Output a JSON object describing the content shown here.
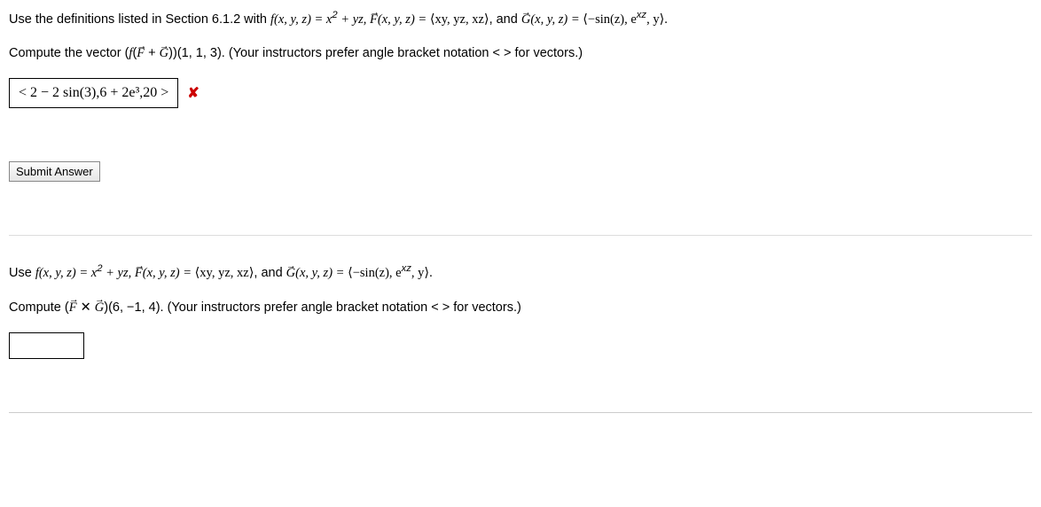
{
  "q1": {
    "defs_prefix": "Use the definitions listed in Section 6.1.2 with ",
    "f_expr": "f(x, y, z) = x",
    "f_exp": "2",
    "f_tail": " + yz, ",
    "F_label": "F",
    "F_args": "(x, y, z) = ",
    "F_vec": "⟨xy, yz, xz⟩",
    "mid": ", and ",
    "G_label": "G",
    "G_args": "(x, y, z) = ",
    "G_open": "⟨−sin(z), e",
    "G_exp": "xz",
    "G_close": ", y⟩.",
    "compute_a": "Compute the vector (",
    "compute_b": "f",
    "compute_c": "(",
    "compute_F": "F",
    "compute_plus": " + ",
    "compute_G": "G",
    "compute_d": "))(1, 1, 3). (Your instructors prefer angle bracket notation < > for vectors.)",
    "answer": "< 2 − 2 sin(3),6 + 2e³,20 >",
    "wrong_mark": "✘"
  },
  "submit_label": "Submit Answer",
  "q2": {
    "prefix": "Use ",
    "f_expr": "f(x, y, z) = x",
    "f_exp": "2",
    "f_tail": " + yz, ",
    "F_label": "F",
    "F_args": "(x, y, z) = ",
    "F_vec": "⟨xy, yz, xz⟩",
    "mid": ", and ",
    "G_label": "G",
    "G_args": "(x, y, z) = ",
    "G_open": "⟨−sin(z), e",
    "G_exp": "xz",
    "G_close": ", y⟩.",
    "compute_a": "Compute (",
    "compute_F": "F",
    "compute_times": " ✕ ",
    "compute_G": "G",
    "compute_b": ")(6, −1, 4). (Your instructors prefer angle bracket notation < > for vectors.)"
  }
}
